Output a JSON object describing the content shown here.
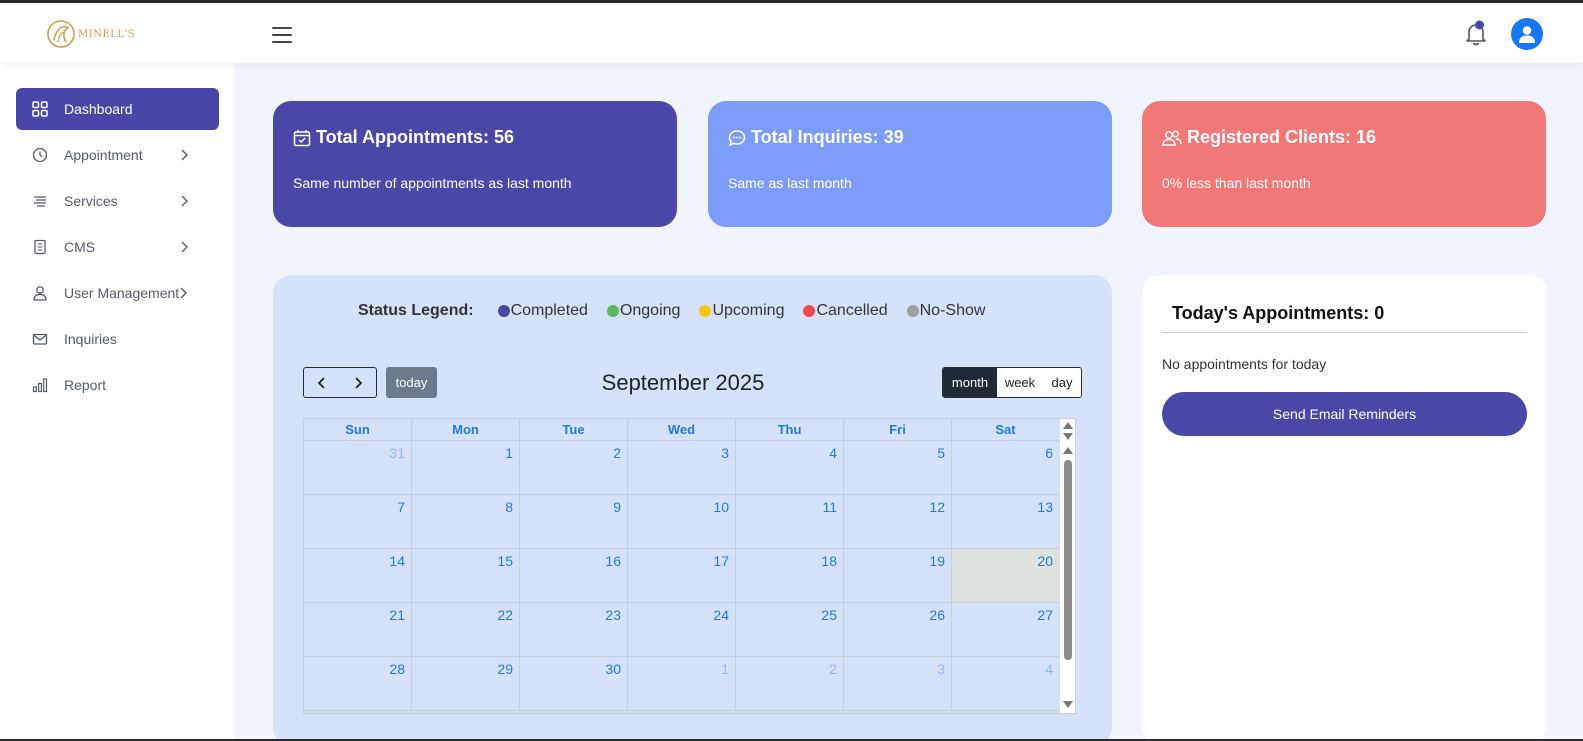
{
  "header": {
    "logo_text": "MINELL'S",
    "notification_dot_color": "#4a47a6",
    "avatar_color": "#1877f2"
  },
  "sidebar": {
    "items": [
      {
        "label": "Dashboard",
        "icon": "grid-icon",
        "active": true,
        "has_submenu": false
      },
      {
        "label": "Appointment",
        "icon": "clock-icon",
        "active": false,
        "has_submenu": true
      },
      {
        "label": "Services",
        "icon": "list-icon",
        "active": false,
        "has_submenu": true
      },
      {
        "label": "CMS",
        "icon": "document-icon",
        "active": false,
        "has_submenu": true
      },
      {
        "label": "User Management",
        "icon": "user-icon",
        "active": false,
        "has_submenu": true
      },
      {
        "label": "Inquiries",
        "icon": "mail-icon",
        "active": false,
        "has_submenu": false
      },
      {
        "label": "Report",
        "icon": "bar-chart-icon",
        "active": false,
        "has_submenu": false
      }
    ]
  },
  "stats": [
    {
      "title": "Total Appointments: 56",
      "subtitle": "Same number of appointments as last month",
      "icon": "calendar-check-icon",
      "color": "#4a47a6"
    },
    {
      "title": "Total Inquiries: 39",
      "subtitle": "Same as last month",
      "icon": "chat-icon",
      "color": "#7c9cf8"
    },
    {
      "title": "Registered Clients: 16",
      "subtitle": "0% less than last month",
      "icon": "users-icon",
      "color": "#f27878"
    }
  ],
  "legend": {
    "label": "Status Legend:",
    "items": [
      {
        "label": "Completed",
        "color": "#4a47a6"
      },
      {
        "label": "Ongoing",
        "color": "#5cb85c"
      },
      {
        "label": "Upcoming",
        "color": "#f5c518"
      },
      {
        "label": "Cancelled",
        "color": "#ef4b4b"
      },
      {
        "label": "No-Show",
        "color": "#9e9e9e"
      }
    ]
  },
  "calendar": {
    "title": "September 2025",
    "today_label": "today",
    "views": [
      "month",
      "week",
      "day"
    ],
    "active_view": "month",
    "days_of_week": [
      "Sun",
      "Mon",
      "Tue",
      "Wed",
      "Thu",
      "Fri",
      "Sat"
    ],
    "weeks": [
      [
        {
          "d": "31",
          "other": true
        },
        {
          "d": "1"
        },
        {
          "d": "2"
        },
        {
          "d": "3"
        },
        {
          "d": "4"
        },
        {
          "d": "5"
        },
        {
          "d": "6"
        }
      ],
      [
        {
          "d": "7"
        },
        {
          "d": "8"
        },
        {
          "d": "9"
        },
        {
          "d": "10"
        },
        {
          "d": "11"
        },
        {
          "d": "12"
        },
        {
          "d": "13"
        }
      ],
      [
        {
          "d": "14"
        },
        {
          "d": "15"
        },
        {
          "d": "16"
        },
        {
          "d": "17"
        },
        {
          "d": "18"
        },
        {
          "d": "19"
        },
        {
          "d": "20",
          "today": true
        }
      ],
      [
        {
          "d": "21"
        },
        {
          "d": "22"
        },
        {
          "d": "23"
        },
        {
          "d": "24"
        },
        {
          "d": "25"
        },
        {
          "d": "26"
        },
        {
          "d": "27"
        }
      ],
      [
        {
          "d": "28"
        },
        {
          "d": "29"
        },
        {
          "d": "30"
        },
        {
          "d": "1",
          "other": true
        },
        {
          "d": "2",
          "other": true
        },
        {
          "d": "3",
          "other": true
        },
        {
          "d": "4",
          "other": true
        }
      ]
    ]
  },
  "today_panel": {
    "title": "Today's Appointments: 0",
    "empty_text": "No appointments for today",
    "button_label": "Send Email Reminders"
  }
}
